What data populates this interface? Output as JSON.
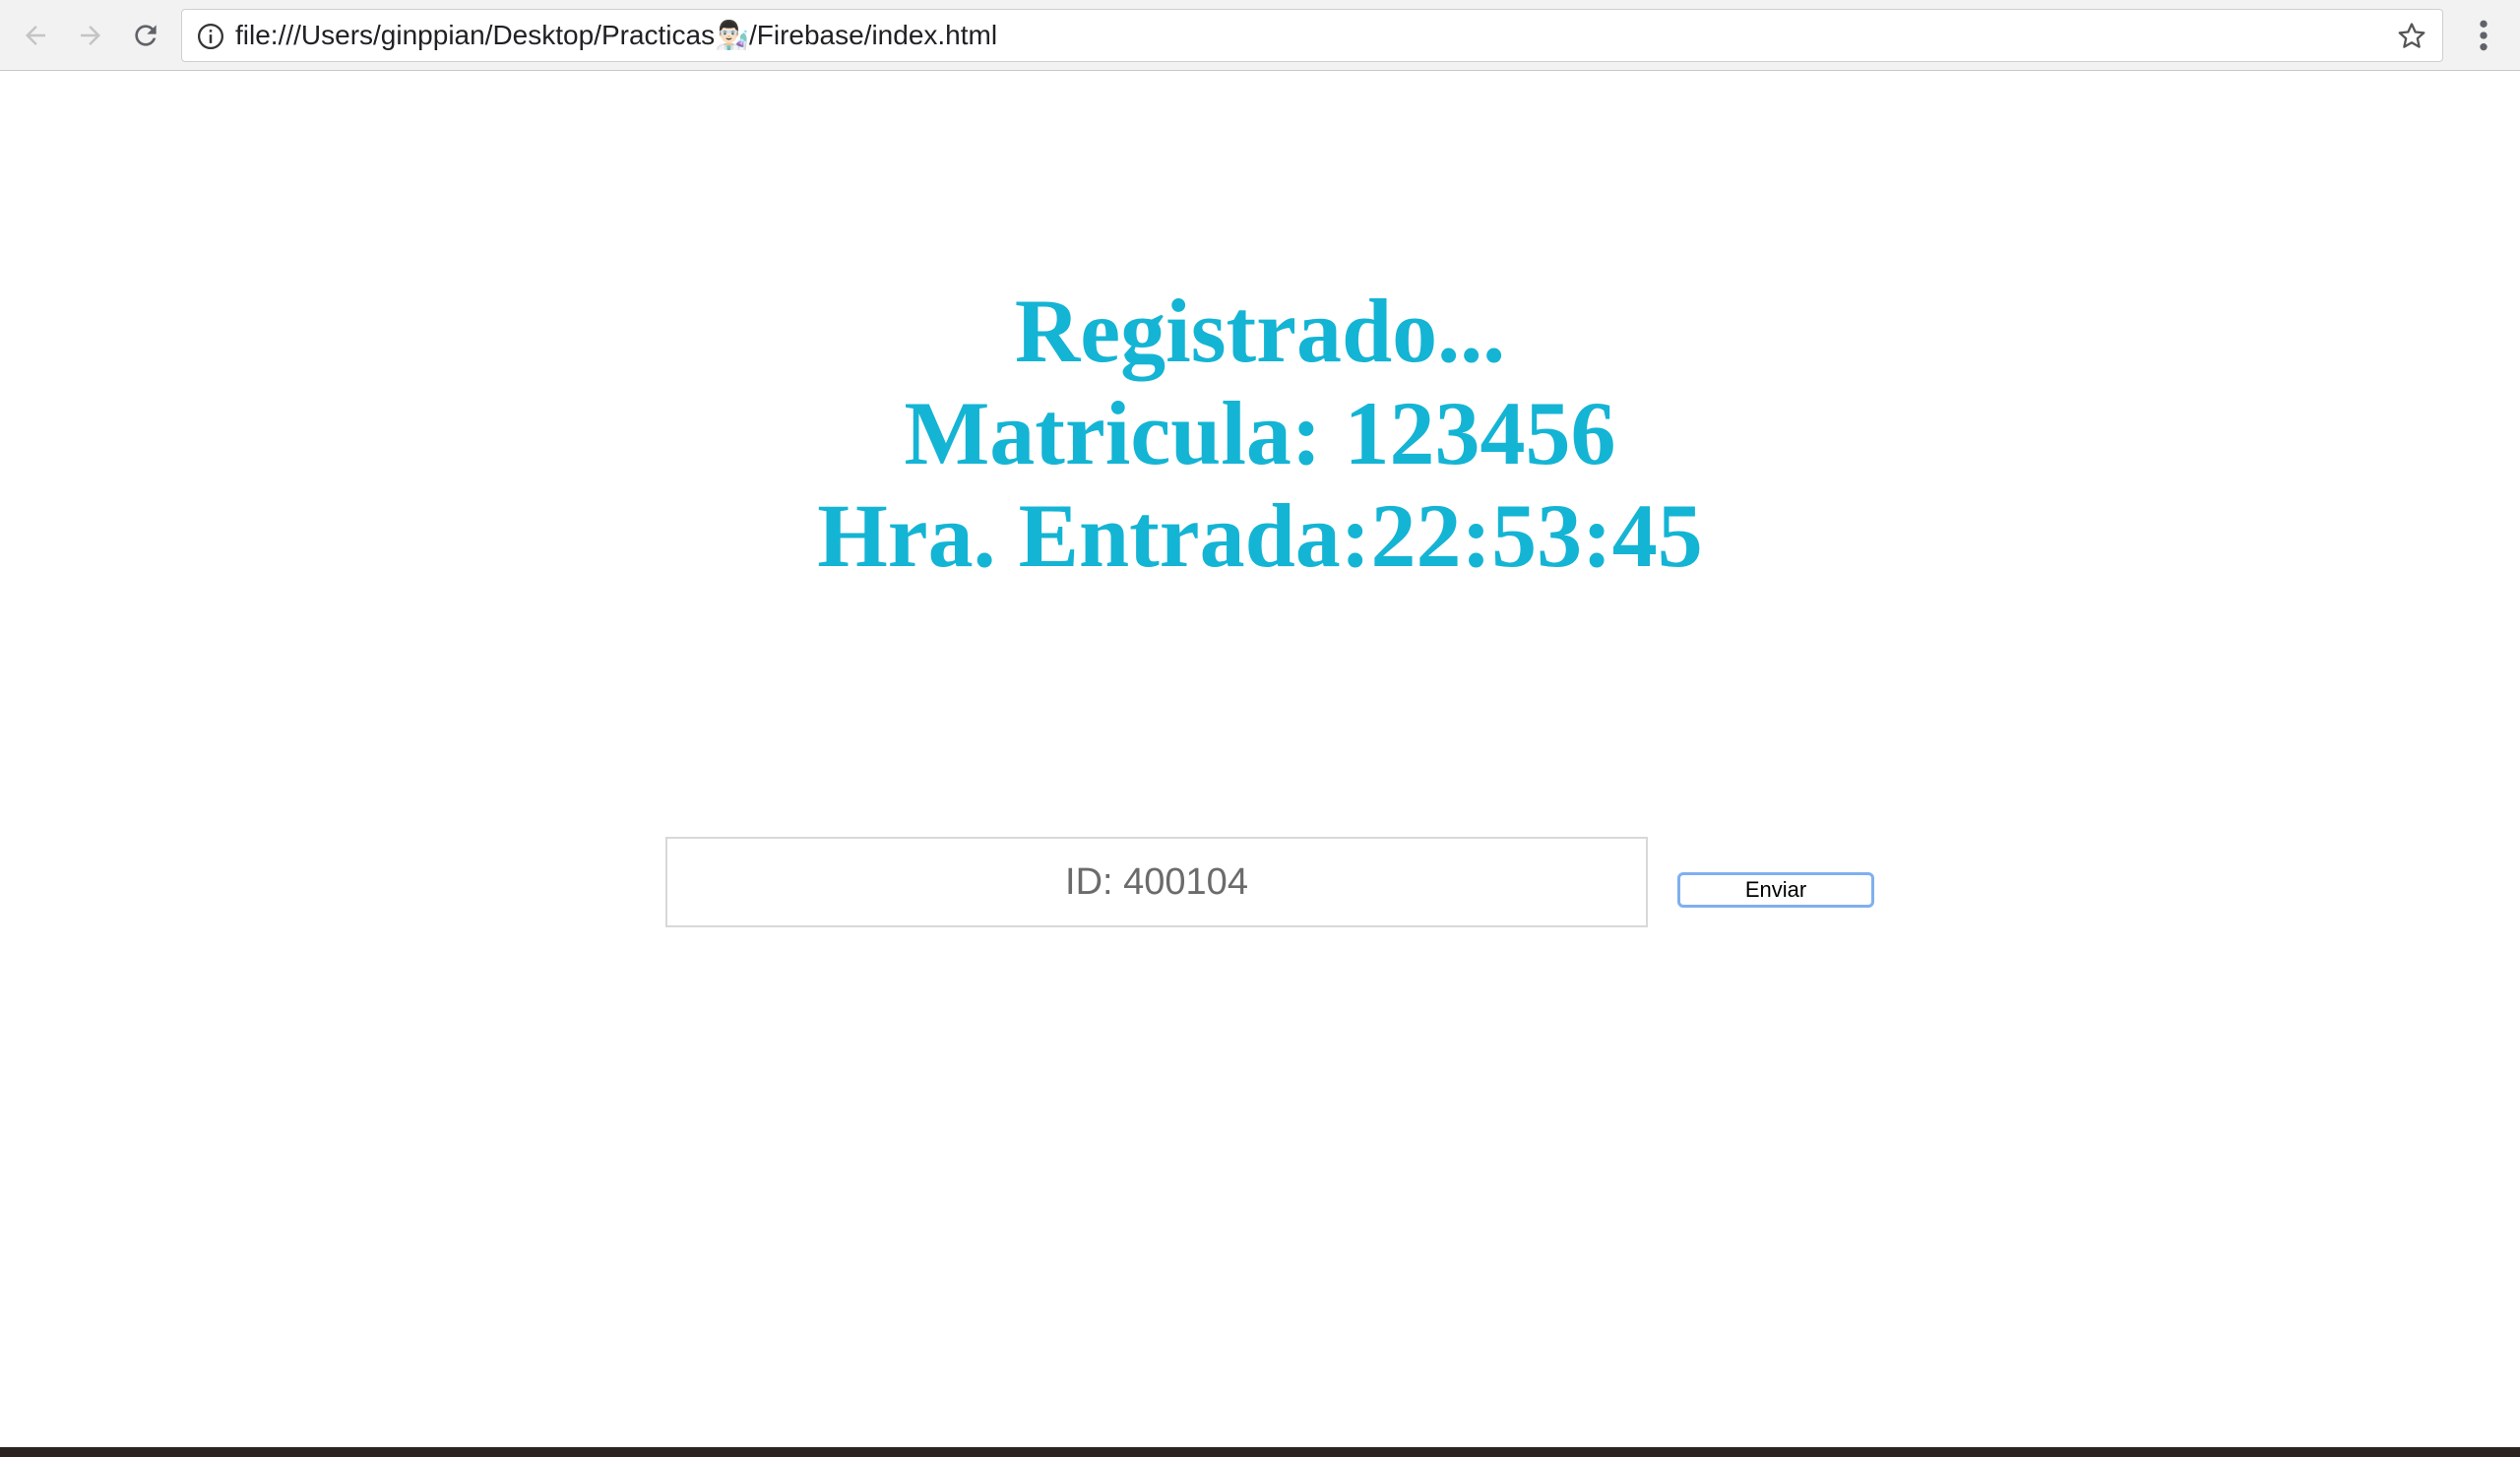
{
  "browser": {
    "url": "file:///Users/ginppian/Desktop/Practicas👨🏻‍🔬/Firebase/index.html",
    "icons": {
      "back": "arrow-left-icon",
      "forward": "arrow-right-icon",
      "reload": "reload-icon",
      "info": "info-icon",
      "bookmark": "star-icon",
      "menu": "kebab-menu-icon"
    }
  },
  "page": {
    "heading_lines": [
      "Registrado...",
      "Matricula: 123456",
      "Hra. Entrada:22:53:45"
    ],
    "id_input": {
      "placeholder": "ID: 400104",
      "value": ""
    },
    "send_button_label": "Enviar",
    "colors": {
      "heading": "#14b4d4",
      "button_border": "#7fb0ee"
    }
  }
}
